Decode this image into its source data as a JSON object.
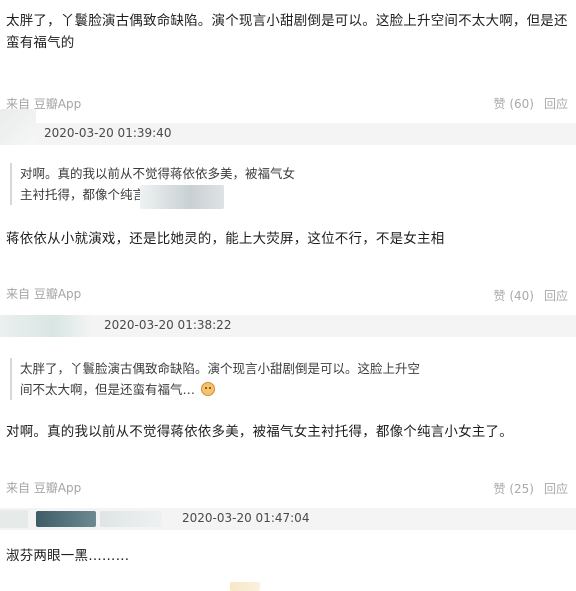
{
  "posts": [
    {
      "text": "太胖了，丫鬟脸演古偶致命缺陷。演个现言小甜剧倒是可以。这脸上升空间不太大啊，但是还蛮有福气的",
      "source": "来自 豆瓣App",
      "likes": "赞 (60)",
      "reply": "回应"
    },
    {
      "timestamp": "2020-03-20 01:39:40",
      "quote": "对啊。真的我以前从不觉得蒋依依多美，被福气女主衬托得，都像个纯言小女主了。",
      "text": "蒋依依从小就演戏，还是比她灵的，能上大荧屏，这位不行，不是女主相",
      "source": "来自 豆瓣App",
      "likes": "赞 (40)",
      "reply": "回应"
    },
    {
      "timestamp": "2020-03-20 01:38:22",
      "quote": "太胖了，丫鬟脸演古偶致命缺陷。演个现言小甜剧倒是可以。这脸上升空间不太大啊，但是还蛮有福气…",
      "text": "对啊。真的我以前从不觉得蒋依依多美，被福气女主衬托得，都像个纯言小女主了。",
      "source": "来自 豆瓣App",
      "likes": "赞 (25)",
      "reply": "回应"
    },
    {
      "timestamp": "2020-03-20 01:47:04",
      "text": "淑芬两眼一黑………"
    }
  ],
  "colors": {
    "user_bar_bg": "#f3f4f3",
    "meta_text": "#a5a5a5",
    "quote_border": "#d7d7d7"
  }
}
